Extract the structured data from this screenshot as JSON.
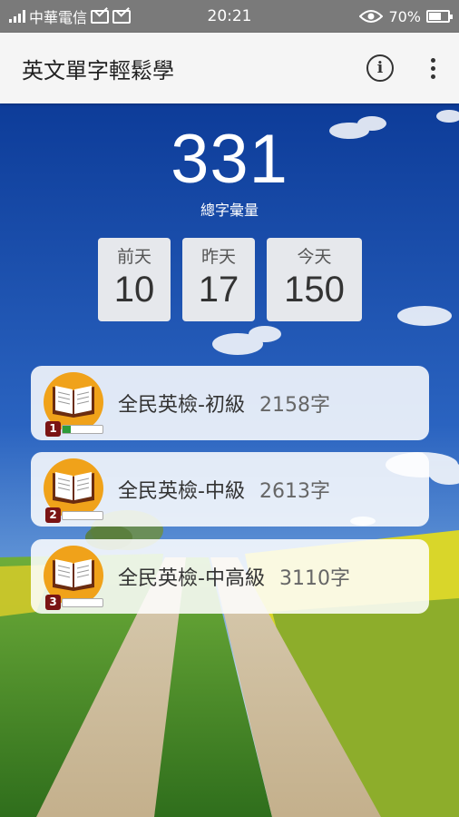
{
  "status_bar": {
    "carrier": "中華電信",
    "time": "20:21",
    "battery": "70%",
    "icons": [
      "signal-icon",
      "mail-icon",
      "mail-icon",
      "eye-icon",
      "battery-icon"
    ]
  },
  "app_bar": {
    "title": "英文單字輕鬆學",
    "info_icon": "info-icon",
    "more_icon": "more-vert-icon"
  },
  "summary": {
    "total": "331",
    "total_label": "總字彙量",
    "days": [
      {
        "label": "前天",
        "value": "10"
      },
      {
        "label": "昨天",
        "value": "17"
      },
      {
        "label": "今天",
        "value": "150"
      }
    ]
  },
  "levels": [
    {
      "name": "全民英檢-初級",
      "count": "2158字",
      "badge": "1",
      "progress": 0.2
    },
    {
      "name": "全民英檢-中級",
      "count": "2613字",
      "badge": "2",
      "progress": 0
    },
    {
      "name": "全民英檢-中高級",
      "count": "3110字",
      "badge": "3",
      "progress": 0
    }
  ],
  "colors": {
    "status_bar": "#7a7a7a",
    "app_bar": "#f5f5f5",
    "book_circle": "#f0a21a",
    "badge": "#7a1414",
    "progress": "#2e9c3a",
    "sky": "#1d4fa8"
  }
}
